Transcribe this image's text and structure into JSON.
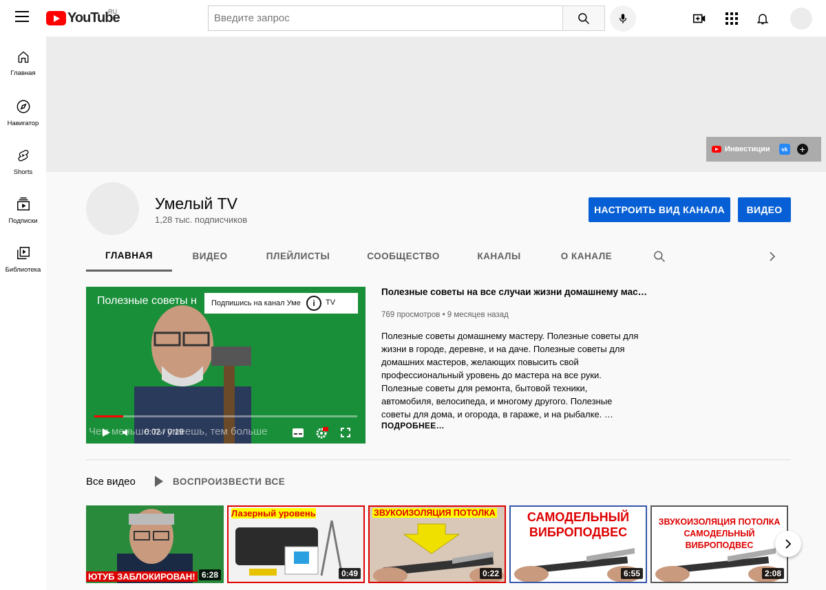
{
  "header": {
    "logo_text": "YouTube",
    "logo_region": "RU",
    "search_placeholder": "Введите запрос"
  },
  "sidebar": {
    "items": [
      {
        "label": "Главная",
        "icon": "home-icon"
      },
      {
        "label": "Навигатор",
        "icon": "compass-icon"
      },
      {
        "label": "Shorts",
        "icon": "shorts-icon"
      },
      {
        "label": "Подписки",
        "icon": "subscriptions-icon"
      },
      {
        "label": "Библиотека",
        "icon": "library-icon"
      }
    ]
  },
  "banner": {
    "links": [
      {
        "label": "Инвестиции",
        "icon": "youtube-icon"
      },
      {
        "label": "",
        "icon": "vk-icon"
      },
      {
        "label": "",
        "icon": "plus-icon"
      }
    ]
  },
  "channel": {
    "name": "Умелый TV",
    "subscribers": "1,28 тыс. подписчиков",
    "customize_label": "НАСТРОИТЬ ВИД КАНАЛА",
    "video_label": "ВИДЕО",
    "tabs": [
      "ГЛАВНАЯ",
      "ВИДЕО",
      "ПЛЕЙЛИСТЫ",
      "СООБЩЕСТВО",
      "КАНАЛЫ",
      "О КАНАЛЕ"
    ],
    "active_tab": "ГЛАВНАЯ"
  },
  "featured": {
    "player_title": "Полезные советы н",
    "subscribe_popup": "Подпишись на канал Уме",
    "subscribe_popup_end": "TV",
    "overlay_text": "Чем меньше ты умеешь, тем больше",
    "time_current": "0:02",
    "time_total": "0:19",
    "time_display": "0:02 / 0:19",
    "progress_fraction": 0.11,
    "title": "Полезные советы на все случаи жизни домашнему масте…",
    "views": "769 просмотров",
    "age": "9 месяцев назад",
    "meta": "769 просмотров • 9 месяцев назад",
    "description": "Полезные советы домашнему мастеру.  Полезные советы для жизни в городе, деревне, и на даче. Полезные советы для домашних мастеров, желающих повысить свой профессиональный уровень до мастера на все руки.  Полезные советы для ремонта, бытовой техники, автомобиля, велосипеда, и многому другого. Полезные советы для дома, и огорода, в гараже, и на рыбалке. …",
    "more_label": "ПОДРОБНЕЕ…"
  },
  "shelf": {
    "title": "Все видео",
    "play_all": "ВОСПРОИЗВЕСТИ ВСЕ",
    "videos": [
      {
        "caption": "ЮТУБ ЗАБЛОКИРОВАН!",
        "duration": "6:28",
        "bg": "#2a8a3c"
      },
      {
        "caption": "Лазерный уровень",
        "duration": "0:49",
        "bg": "#f2f2f2"
      },
      {
        "caption": "ЗВУКОИЗОЛЯЦИЯ ПОТОЛКА",
        "duration": "0:22",
        "bg": "#d9c8b8"
      },
      {
        "caption": "САМОДЕЛЬНЫЙ ВИБРОПОДВЕС",
        "duration": "6:55",
        "bg": "#ffffff"
      },
      {
        "caption": "ЗВУКОИЗОЛЯЦИЯ ПОТОЛКА САМОДЕЛЬНЫЙ ВИБРОПОДВЕС",
        "duration": "2:08",
        "bg": "#ffffff"
      }
    ]
  },
  "colors": {
    "accent": "#065fd4",
    "brand_red": "#ff0000",
    "background": "#f9f9f9"
  }
}
